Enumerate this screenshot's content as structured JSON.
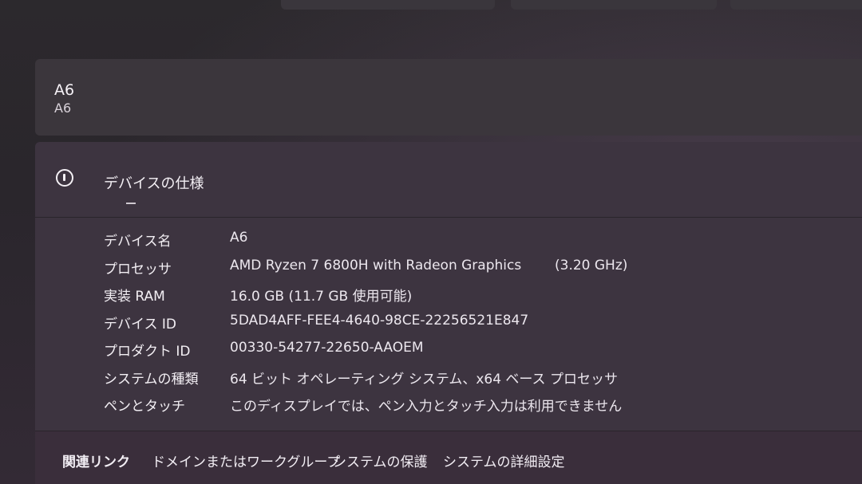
{
  "device_card": {
    "name": "A6",
    "subtitle": "A6"
  },
  "device_specs": {
    "title": "デバイスの仕様",
    "rows": [
      {
        "label": "デバイス名",
        "value": "A6",
        "extra": ""
      },
      {
        "label": "プロセッサ",
        "value": "AMD Ryzen 7 6800H with Radeon Graphics",
        "extra": "(3.20 GHz)"
      },
      {
        "label": "実装 RAM",
        "value": "16.0 GB (11.7 GB 使用可能)",
        "extra": ""
      },
      {
        "label": "デバイス ID",
        "value": "5DAD4AFF-FEE4-4640-98CE-22256521E847",
        "extra": ""
      },
      {
        "label": "プロダクト ID",
        "value": "00330-54277-22650-AAOEM",
        "extra": ""
      },
      {
        "label": "システムの種類",
        "value": "64 ビット オペレーティング システム、x64 ベース プロセッサ",
        "extra": ""
      },
      {
        "label": "ペンとタッチ",
        "value": "このディスプレイでは、ペン入力とタッチ入力は利用できません",
        "extra": ""
      }
    ]
  },
  "related_links": {
    "label": "関連リンク",
    "links": [
      "ドメインまたはワークグループ",
      "システムの保護",
      "システムの詳細設定"
    ]
  },
  "icons": {
    "spec_header_icon": "info-icon"
  },
  "colors": {
    "background": "#262327",
    "card": "#3d3440",
    "text": "#f2eef4"
  }
}
